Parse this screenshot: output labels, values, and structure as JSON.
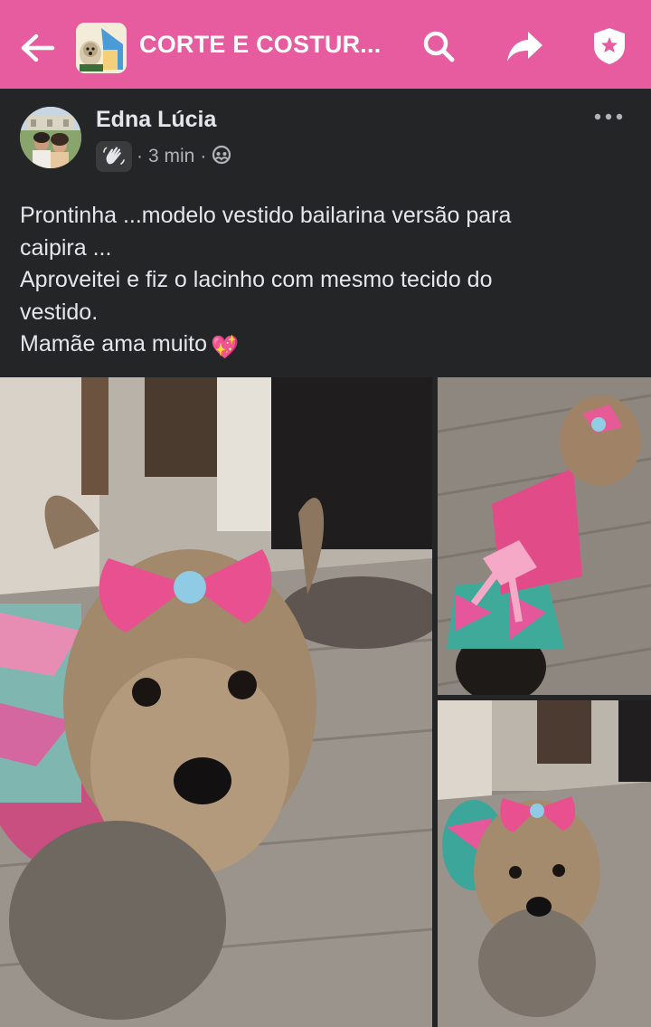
{
  "header": {
    "group_title": "CORTE E COSTUR...",
    "background_color": "#e75c9f",
    "icons": [
      "back-arrow-icon",
      "search-icon",
      "share-icon",
      "shield-star-icon"
    ]
  },
  "post": {
    "author": "Edna Lúcia",
    "badge_icon": "waving-hand-icon",
    "separator": "·",
    "time": "3 min",
    "privacy_icon": "group-audience-icon",
    "text_lines": [
      "Prontinha ...modelo vestido bailarina versão para",
      "caipira ...",
      "Aproveitei e fiz o lacinho com mesmo tecido do",
      "vestido.",
      "Mamãe ama muito"
    ],
    "emoji": "💖"
  },
  "photos": {
    "count": 3,
    "subject": "yorkshire-terrier-with-pink-bow"
  },
  "colors": {
    "background": "#242526",
    "primary_text": "#e4e6eb",
    "secondary_text": "#b0b3b8",
    "accent_pink": "#e75c9f"
  }
}
